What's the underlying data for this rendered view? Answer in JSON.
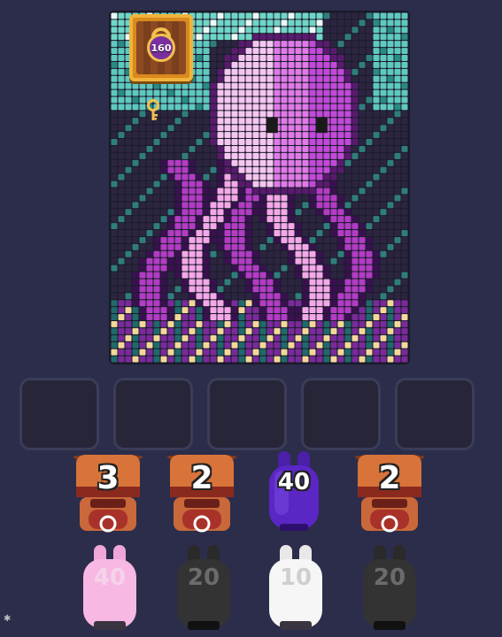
{
  "lock": {
    "count": "160"
  },
  "slots": [
    {
      "id": 1
    },
    {
      "id": 2
    },
    {
      "id": 3
    },
    {
      "id": 4
    },
    {
      "id": 5
    }
  ],
  "pieces_row1": [
    {
      "kind": "bull",
      "value": "3"
    },
    {
      "kind": "bull",
      "value": "2"
    },
    {
      "kind": "bunny",
      "color": "purple",
      "value": "40"
    },
    {
      "kind": "bull",
      "value": "2"
    }
  ],
  "pieces_row2": [
    {
      "kind": "bunny",
      "color": "pink",
      "value": "40"
    },
    {
      "kind": "bunny",
      "color": "black",
      "value": "20"
    },
    {
      "kind": "bunny",
      "color": "white",
      "value": "10"
    },
    {
      "kind": "bunny",
      "color": "black",
      "value": "20"
    }
  ],
  "colors": {
    "background": "#2c2d4a",
    "lock_gold": "#d98a1c",
    "octopus_pink": "#f4a8e8",
    "octopus_purple": "#b23cc4",
    "water_teal": "#5fc9c0"
  }
}
